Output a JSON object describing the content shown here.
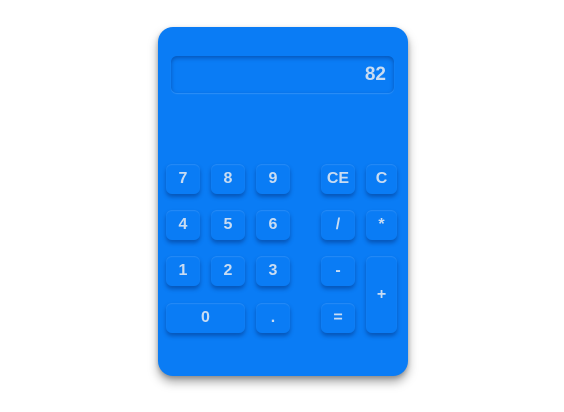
{
  "display": {
    "value": "82"
  },
  "keys": {
    "k7": "7",
    "k8": "8",
    "k9": "9",
    "ce": "CE",
    "c": "C",
    "k4": "4",
    "k5": "5",
    "k6": "6",
    "divide": "/",
    "multiply": "*",
    "k1": "1",
    "k2": "2",
    "k3": "3",
    "subtract": "-",
    "add": "+",
    "k0": "0",
    "decimal": ".",
    "equals": "="
  },
  "colors": {
    "body": "#0a7cf5",
    "text": "#c9dcf2",
    "background": "#ffffff"
  }
}
